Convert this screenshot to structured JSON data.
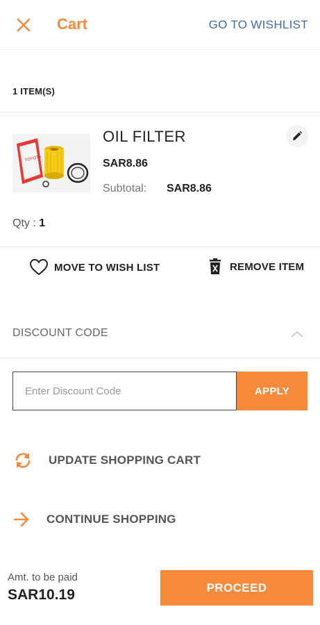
{
  "header": {
    "title": "Cart",
    "wishlist_link": "GO TO WISHLIST"
  },
  "cart": {
    "items_count": "1 ITEM(S)",
    "item": {
      "name": "OIL FILTER",
      "price": "SAR8.86",
      "subtotal_label": "Subtotal:",
      "subtotal_value": "SAR8.86",
      "qty_label": "Qty :",
      "qty_value": "1"
    },
    "actions": {
      "move_to_wishlist": "MOVE TO WISH LIST",
      "remove_item": "REMOVE ITEM"
    }
  },
  "discount": {
    "title": "DISCOUNT CODE",
    "input_value": "",
    "placeholder": "Enter Discount Code",
    "apply_label": "APPLY"
  },
  "links": {
    "update_cart": "UPDATE SHOPPING CART",
    "continue_shopping": "CONTINUE SHOPPING"
  },
  "footer": {
    "amount_label": "Amt. to be paid",
    "amount_value": "SAR10.19",
    "proceed_label": "PROCEED"
  },
  "colors": {
    "accent": "#f7893b",
    "link": "#3f6bb5"
  }
}
